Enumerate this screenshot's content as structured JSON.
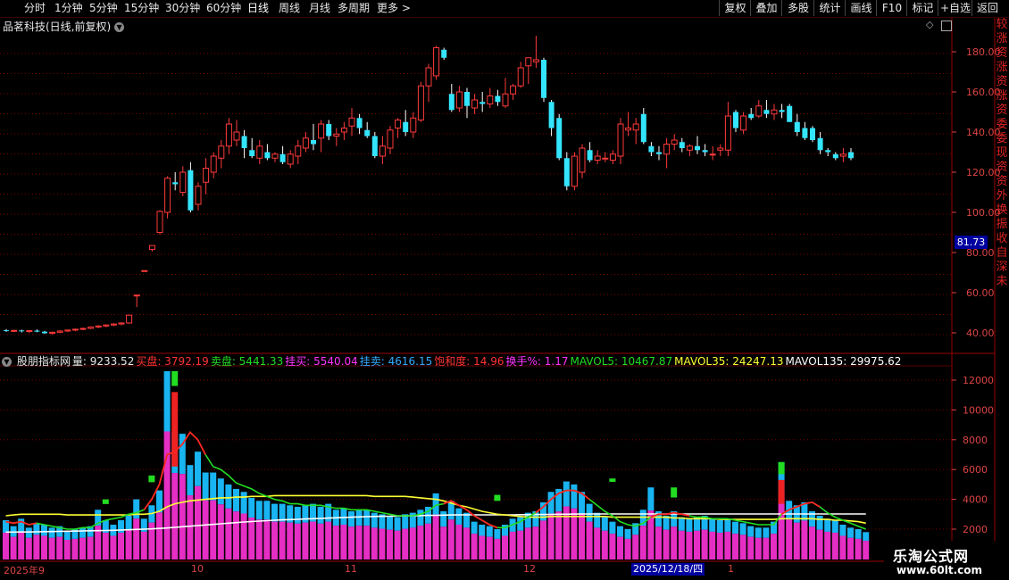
{
  "toolbar": {
    "periods": [
      "分时",
      "1分钟",
      "5分钟",
      "15分钟",
      "30分钟",
      "60分钟",
      "日线",
      "周线",
      "月线",
      "多周期"
    ],
    "more": "更多",
    "right_buttons": [
      "复权",
      "叠加",
      "多股",
      "统计",
      "画线",
      "F10",
      "标记",
      "+自选",
      "返回"
    ]
  },
  "stock": {
    "title": "品茗科技(日线,前复权)"
  },
  "price_axis": {
    "ticks": [
      "180.00",
      "160.00",
      "140.00",
      "120.00",
      "100.00",
      "80.00",
      "60.00",
      "40.00"
    ],
    "current": "81.73"
  },
  "volume_axis": {
    "ticks": [
      "12000",
      "10000",
      "8000",
      "6000",
      "4000",
      "2000"
    ]
  },
  "indicator": [
    {
      "text": "股朋指标网",
      "color": "#e8e8e8"
    },
    {
      "text": "量: 9233.52",
      "color": "#e8e8e8"
    },
    {
      "text": "买盘: 3792.19",
      "color": "#ff3333"
    },
    {
      "text": "卖盘: 5441.33",
      "color": "#22dd22"
    },
    {
      "text": "挂买: 5540.04",
      "color": "#ff33ff"
    },
    {
      "text": "挂卖: 4616.15",
      "color": "#33aaff"
    },
    {
      "text": "饱和度: 14.96",
      "color": "#ff3333"
    },
    {
      "text": "换手%: 1.17",
      "color": "#ff33ff"
    },
    {
      "text": "MAVOL5: 10467.87",
      "color": "#22dd22"
    },
    {
      "text": "MAVOL35: 24247.13",
      "color": "#ffff33"
    },
    {
      "text": "MAVOL135: 29975.62",
      "color": "#ffffff"
    }
  ],
  "date_axis": {
    "labels": [
      "2025年9",
      "10",
      "11",
      "12",
      "1"
    ],
    "cursor": "2025/12/18/四"
  },
  "right_strip": {
    "chars": [
      "较",
      "涨",
      "资",
      "涨",
      "资",
      "涨",
      "资",
      "委",
      "委",
      "现",
      "资",
      "资",
      "外",
      "换",
      "振",
      "收",
      "自",
      "深",
      "未"
    ]
  },
  "watermark": {
    "line1": "乐淘公式网",
    "line2": "www.60lt.com"
  },
  "colors": {
    "up": "#ff3a3a",
    "down": "#33e5ff",
    "grid": "#7a0000",
    "vol_pink": "#e52ec4",
    "vol_cyan": "#19b4f2"
  },
  "candles": [
    [
      41.3,
      41.9,
      40.5,
      41.0
    ],
    [
      41.0,
      41.5,
      40.4,
      41.2
    ],
    [
      41.2,
      41.6,
      40.2,
      40.8
    ],
    [
      40.8,
      41.4,
      40.0,
      41.1
    ],
    [
      41.1,
      41.7,
      40.3,
      40.6
    ],
    [
      40.6,
      41.0,
      39.5,
      39.8
    ],
    [
      39.8,
      40.6,
      39.1,
      40.3
    ],
    [
      40.3,
      41.3,
      39.8,
      40.9
    ],
    [
      40.9,
      41.6,
      40.4,
      41.4
    ],
    [
      41.4,
      42.1,
      40.8,
      41.8
    ],
    [
      41.8,
      42.6,
      41.3,
      42.2
    ],
    [
      42.2,
      43.2,
      41.8,
      42.9
    ],
    [
      42.9,
      43.9,
      42.3,
      43.4
    ],
    [
      43.4,
      44.3,
      42.8,
      43.9
    ],
    [
      43.9,
      44.8,
      43.3,
      44.4
    ],
    [
      44.4,
      45.3,
      43.8,
      44.9
    ],
    [
      44.9,
      49.0,
      44.5,
      48.8
    ],
    [
      58.8,
      58.8,
      52.8,
      58.8
    ],
    [
      71.0,
      71.0,
      70.6,
      71.0
    ],
    [
      81.5,
      83.5,
      80.5,
      83.5
    ],
    [
      90.0,
      101.0,
      89.0,
      100.5
    ],
    [
      100.0,
      118.0,
      97.0,
      117.0
    ],
    [
      115.0,
      120.0,
      111.0,
      114.0
    ],
    [
      110.0,
      123.0,
      108.0,
      120.0
    ],
    [
      121.0,
      125.0,
      100.0,
      101.0
    ],
    [
      104.0,
      115.0,
      101.0,
      113.0
    ],
    [
      115.0,
      127.0,
      109.0,
      122.0
    ],
    [
      120.0,
      130.0,
      117.0,
      128.0
    ],
    [
      127.0,
      136.0,
      122.0,
      133.0
    ],
    [
      133.0,
      147.0,
      129.0,
      144.0
    ],
    [
      136.0,
      146.0,
      133.0,
      140.0
    ],
    [
      138.0,
      141.0,
      127.0,
      132.0
    ],
    [
      131.0,
      137.0,
      127.0,
      128.0
    ],
    [
      127.0,
      136.0,
      124.0,
      133.0
    ],
    [
      130.0,
      134.0,
      126.0,
      127.0
    ],
    [
      127.0,
      130.0,
      125.0,
      129.0
    ],
    [
      129.0,
      133.0,
      124.0,
      125.0
    ],
    [
      124.0,
      131.0,
      122.0,
      129.0
    ],
    [
      128.0,
      136.0,
      124.0,
      133.0
    ],
    [
      132.0,
      140.0,
      130.0,
      137.0
    ],
    [
      136.0,
      144.0,
      131.0,
      134.0
    ],
    [
      137.0,
      146.0,
      130.0,
      144.0
    ],
    [
      144.0,
      146.0,
      136.0,
      138.0
    ],
    [
      138.0,
      142.0,
      133.0,
      139.0
    ],
    [
      140.0,
      145.0,
      136.0,
      142.0
    ],
    [
      143.0,
      152.0,
      138.0,
      147.0
    ],
    [
      147.0,
      149.0,
      139.0,
      142.0
    ],
    [
      141.0,
      145.0,
      137.0,
      138.0
    ],
    [
      138.0,
      140.0,
      127.0,
      128.0
    ],
    [
      128.0,
      138.0,
      124.0,
      133.0
    ],
    [
      132.0,
      143.0,
      129.0,
      141.0
    ],
    [
      142.0,
      147.0,
      137.0,
      146.0
    ],
    [
      145.0,
      151.0,
      138.0,
      140.0
    ],
    [
      140.0,
      150.0,
      137.0,
      147.0
    ],
    [
      146.0,
      165.0,
      145.0,
      163.0
    ],
    [
      163.0,
      174.0,
      155.0,
      172.0
    ],
    [
      168.0,
      183.0,
      166.0,
      182.0
    ],
    [
      181.0,
      182.0,
      176.0,
      177.0
    ],
    [
      159.0,
      164.0,
      150.0,
      151.0
    ],
    [
      152.0,
      163.0,
      150.0,
      160.0
    ],
    [
      160.0,
      162.0,
      147.0,
      153.0
    ],
    [
      152.0,
      159.0,
      149.0,
      156.0
    ],
    [
      155.0,
      160.0,
      150.0,
      154.0
    ],
    [
      154.0,
      162.0,
      152.0,
      158.0
    ],
    [
      158.0,
      161.0,
      153.0,
      155.0
    ],
    [
      153.0,
      167.0,
      152.0,
      159.0
    ],
    [
      159.0,
      164.0,
      156.0,
      163.0
    ],
    [
      163.0,
      175.0,
      162.0,
      172.0
    ],
    [
      173.0,
      177.0,
      164.0,
      177.0
    ],
    [
      175.0,
      188.0,
      172.0,
      176.0
    ],
    [
      176.0,
      177.0,
      155.0,
      157.0
    ],
    [
      155.0,
      156.0,
      138.0,
      142.0
    ],
    [
      147.0,
      149.0,
      126.0,
      127.0
    ],
    [
      127.0,
      130.0,
      111.0,
      113.0
    ],
    [
      113.0,
      130.0,
      111.0,
      128.0
    ],
    [
      120.0,
      134.0,
      117.0,
      132.0
    ],
    [
      131.0,
      135.0,
      125.0,
      126.0
    ],
    [
      126.0,
      131.0,
      124.0,
      128.0
    ],
    [
      127.0,
      130.0,
      125.0,
      127.0
    ],
    [
      126.0,
      131.0,
      124.0,
      129.0
    ],
    [
      128.0,
      147.0,
      124.0,
      144.0
    ],
    [
      141.0,
      150.0,
      138.0,
      142.0
    ],
    [
      141.0,
      147.0,
      134.0,
      144.0
    ],
    [
      149.0,
      152.0,
      134.0,
      135.0
    ],
    [
      133.0,
      135.0,
      128.0,
      130.0
    ],
    [
      130.0,
      133.0,
      126.0,
      129.0
    ],
    [
      129.0,
      137.0,
      122.0,
      134.0
    ],
    [
      134.0,
      139.0,
      131.0,
      136.0
    ],
    [
      135.0,
      137.0,
      130.0,
      132.0
    ],
    [
      131.0,
      134.0,
      128.0,
      133.0
    ],
    [
      133.0,
      138.0,
      129.0,
      131.0
    ],
    [
      131.0,
      134.0,
      128.0,
      130.0
    ],
    [
      129.0,
      133.0,
      126.0,
      129.0
    ],
    [
      131.0,
      134.0,
      128.0,
      132.0
    ],
    [
      131.0,
      155.0,
      128.0,
      148.0
    ],
    [
      150.0,
      151.0,
      140.0,
      142.0
    ],
    [
      141.0,
      150.0,
      139.0,
      148.0
    ],
    [
      149.0,
      152.0,
      146.0,
      147.0
    ],
    [
      148.0,
      156.0,
      147.0,
      153.0
    ],
    [
      151.0,
      156.0,
      147.0,
      149.0
    ],
    [
      149.0,
      154.0,
      146.0,
      151.0
    ],
    [
      151.0,
      154.0,
      147.0,
      150.0
    ],
    [
      153.0,
      154.0,
      146.0,
      145.0
    ],
    [
      145.0,
      149.0,
      138.0,
      140.0
    ],
    [
      142.0,
      145.0,
      136.0,
      137.0
    ],
    [
      142.0,
      143.0,
      135.0,
      136.0
    ],
    [
      137.0,
      140.0,
      129.0,
      131.0
    ],
    [
      131.0,
      132.0,
      128.0,
      130.0
    ],
    [
      129.0,
      130.0,
      126.0,
      127.0
    ],
    [
      128.0,
      132.0,
      125.0,
      129.0
    ],
    [
      130.0,
      132.0,
      126.0,
      127.0
    ]
  ],
  "volume": [
    2600,
    2200,
    2700,
    2100,
    2400,
    2300,
    2100,
    2200,
    1900,
    2000,
    2100,
    2200,
    3300,
    2600,
    2300,
    2600,
    2900,
    4000,
    2700,
    3600,
    4600,
    12600,
    8500,
    8400,
    6300,
    7200,
    5800,
    5800,
    5400,
    5000,
    4700,
    4500,
    4100,
    3900,
    3900,
    3700,
    3700,
    3600,
    3500,
    3600,
    3700,
    3500,
    3700,
    3300,
    3400,
    3200,
    3300,
    3300,
    3100,
    3000,
    2900,
    2800,
    3000,
    3100,
    3300,
    3500,
    4400,
    3200,
    3900,
    3400,
    3100,
    2500,
    2300,
    2200,
    2000,
    2300,
    2700,
    2800,
    3100,
    3200,
    3800,
    4500,
    4700,
    5200,
    5000,
    4500,
    3700,
    3100,
    2800,
    2500,
    2200,
    2000,
    2400,
    3300,
    4800,
    3200,
    2900,
    3200,
    2800,
    2700,
    2800,
    2900,
    2700,
    2600,
    2700,
    2500,
    2400,
    2200,
    2100,
    2100,
    2500,
    6500,
    3900,
    3600,
    3800,
    3200,
    2900,
    2700,
    2600,
    2300,
    2100,
    2000,
    1800
  ],
  "mavol5": [
    2500,
    2400,
    2500,
    2300,
    2400,
    2300,
    2200,
    2100,
    2000,
    2000,
    2100,
    2100,
    2400,
    2600,
    2700,
    2800,
    3000,
    3100,
    3300,
    4000,
    5000,
    7000,
    7200,
    7700,
    8500,
    8000,
    7000,
    6200,
    6000,
    5600,
    5100,
    4900,
    4700,
    4400,
    4200,
    4000,
    3900,
    3700,
    3700,
    3600,
    3600,
    3600,
    3500,
    3400,
    3400,
    3300,
    3300,
    3300,
    3200,
    3100,
    3000,
    2900,
    2900,
    2900,
    3000,
    3200,
    3600,
    3700,
    3900,
    3600,
    3300,
    2900,
    2600,
    2300,
    2100,
    2100,
    2300,
    2500,
    2800,
    3100,
    3500,
    4000,
    4400,
    4600,
    4600,
    4400,
    4000,
    3600,
    3200,
    2900,
    2500,
    2300,
    2200,
    2400,
    2800,
    3000,
    3000,
    3100,
    3000,
    2900,
    2800,
    2800,
    2700,
    2700,
    2700,
    2600,
    2500,
    2400,
    2300,
    2300,
    2300,
    3000,
    3300,
    3500,
    3700,
    3800,
    3500,
    3100,
    2800,
    2600,
    2400,
    2200,
    2000
  ],
  "mavol35": [
    2900,
    2950,
    3000,
    3000,
    3000,
    3000,
    3000,
    3000,
    2950,
    2950,
    2950,
    2950,
    2950,
    2950,
    2950,
    2950,
    2950,
    3000,
    3000,
    3050,
    3200,
    3500,
    3700,
    3800,
    3900,
    3950,
    4000,
    4050,
    4100,
    4100,
    4150,
    4150,
    4200,
    4200,
    4200,
    4250,
    4250,
    4250,
    4250,
    4250,
    4250,
    4250,
    4250,
    4250,
    4250,
    4250,
    4250,
    4250,
    4200,
    4200,
    4200,
    4200,
    4200,
    4150,
    4100,
    4050,
    4000,
    3900,
    3750,
    3600,
    3500,
    3350,
    3200,
    3100,
    3000,
    2950,
    2900,
    2850,
    2800,
    2800,
    2800,
    2850,
    2850,
    2850,
    2850,
    2850,
    2850,
    2850,
    2850,
    2800,
    2800,
    2800,
    2800,
    2800,
    2800,
    2800,
    2800,
    2750,
    2750,
    2700,
    2700,
    2700,
    2700,
    2650,
    2650,
    2650,
    2650,
    2650,
    2650,
    2650,
    2650,
    2700,
    2700,
    2700,
    2700,
    2700,
    2650,
    2650,
    2600,
    2600,
    2550,
    2500,
    2400
  ],
  "mavol135": [
    1800,
    1800,
    1810,
    1810,
    1820,
    1830,
    1840,
    1850,
    1860,
    1870,
    1880,
    1890,
    1900,
    1910,
    1920,
    1940,
    1960,
    1980,
    2000,
    2020,
    2050,
    2080,
    2120,
    2160,
    2200,
    2240,
    2280,
    2320,
    2360,
    2400,
    2440,
    2480,
    2510,
    2540,
    2570,
    2600,
    2620,
    2640,
    2660,
    2680,
    2700,
    2720,
    2740,
    2760,
    2780,
    2800,
    2820,
    2840,
    2850,
    2860,
    2870,
    2880,
    2890,
    2900,
    2910,
    2920,
    2930,
    2940,
    2950,
    2960,
    2960,
    2960,
    2960,
    2960,
    2960,
    2960,
    2960,
    2970,
    2970,
    2980,
    2980,
    2990,
    3000,
    3000,
    3010,
    3010,
    3020,
    3020,
    3020,
    3020,
    3020,
    3020,
    3020,
    3020,
    3020,
    3020,
    3020,
    3020,
    3020,
    3020,
    3020,
    3020,
    3020,
    3020,
    3020,
    3020,
    3020,
    3020,
    3020,
    3020,
    3020,
    3020,
    3020,
    3020,
    3020,
    3020,
    3020,
    3020,
    3020,
    3020,
    3020,
    3020,
    3020
  ]
}
